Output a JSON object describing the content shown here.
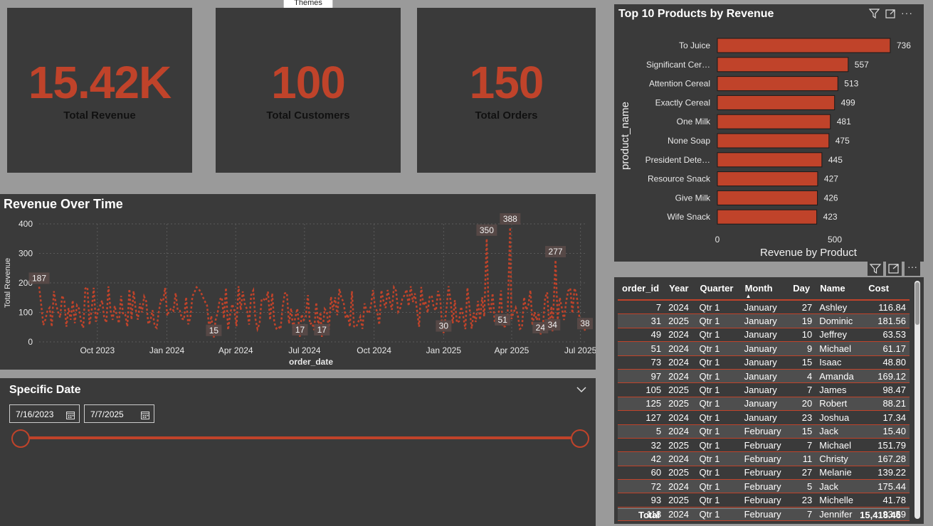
{
  "tooltip": "Themes",
  "kpis": [
    {
      "value": "15.42K",
      "label": "Total Revenue"
    },
    {
      "value": "100",
      "label": "Total Customers"
    },
    {
      "value": "150",
      "label": "Total Orders"
    }
  ],
  "colors": {
    "accent": "#c0432a",
    "panel": "#3a3a3a",
    "canvas": "#9a9a9a"
  },
  "revenue_chart": {
    "title": "Revenue Over Time",
    "ylabel": "Total Revenue",
    "xlabel": "order_date",
    "yticks": [
      "400",
      "300",
      "200",
      "100",
      "0"
    ],
    "xticks": [
      "Oct 2023",
      "Jan 2024",
      "Apr 2024",
      "Jul 2024",
      "Oct 2024",
      "Jan 2025",
      "Apr 2025",
      "Jul 2025"
    ],
    "point_labels": [
      "187",
      "15",
      "17",
      "17",
      "30",
      "350",
      "51",
      "388",
      "24",
      "34",
      "277",
      "38"
    ]
  },
  "slicer": {
    "title": "Specific Date",
    "start": "7/16/2023",
    "end": "7/7/2025",
    "chevron": "chevron-down-icon",
    "calendar_icon": "calendar-icon"
  },
  "products_chart": {
    "title": "Top 10 Products by Revenue",
    "ylabel": "product_name",
    "xlabel": "Revenue by Product",
    "xticks": [
      "0",
      "500"
    ],
    "icons": [
      "filter-icon",
      "focus-mode-icon",
      "more-options-icon"
    ]
  },
  "chart_data": [
    {
      "type": "bar",
      "title": "Top 10 Products by Revenue",
      "xlabel": "Revenue by Product",
      "ylabel": "product_name",
      "categories": [
        "To Juice",
        "Significant Cer…",
        "Attention Cereal",
        "Exactly Cereal",
        "One Milk",
        "None Soap",
        "President Dete…",
        "Resource Snack",
        "Give Milk",
        "Wife Snack"
      ],
      "values": [
        736,
        557,
        513,
        499,
        481,
        475,
        445,
        427,
        426,
        423
      ],
      "value_labels": [
        "736",
        "557",
        "513",
        "499",
        "481",
        "475",
        "445",
        "427",
        "426",
        "423"
      ],
      "xlim": [
        0,
        800
      ],
      "orientation": "horizontal",
      "grid": false
    },
    {
      "type": "line",
      "title": "Revenue Over Time",
      "xlabel": "order_date",
      "ylabel": "Total Revenue",
      "ylim": [
        0,
        400
      ],
      "x_range": [
        "2023-07-16",
        "2025-07-07"
      ],
      "grid": true,
      "labeled_points": [
        {
          "x": "2023-07-16",
          "y": 187
        },
        {
          "x": "2024-03-03",
          "y": 15
        },
        {
          "x": "2024-06-25",
          "y": 17
        },
        {
          "x": "2024-07-24",
          "y": 17
        },
        {
          "x": "2025-01-01",
          "y": 30
        },
        {
          "x": "2025-02-27",
          "y": 350
        },
        {
          "x": "2025-03-20",
          "y": 51
        },
        {
          "x": "2025-03-30",
          "y": 388
        },
        {
          "x": "2025-05-09",
          "y": 24
        },
        {
          "x": "2025-05-25",
          "y": 34
        },
        {
          "x": "2025-05-29",
          "y": 277
        },
        {
          "x": "2025-07-07",
          "y": 38
        }
      ]
    }
  ],
  "table": {
    "icons": [
      "filter-icon",
      "focus-mode-icon",
      "more-options-icon"
    ],
    "columns": [
      "order_id",
      "Year",
      "Quarter",
      "Month",
      "Day",
      "Name",
      "Cost"
    ],
    "rows": [
      [
        "7",
        "2024",
        "Qtr 1",
        "January",
        "27",
        "Ashley",
        "116.84"
      ],
      [
        "31",
        "2025",
        "Qtr 1",
        "January",
        "19",
        "Dominic",
        "181.56"
      ],
      [
        "49",
        "2024",
        "Qtr 1",
        "January",
        "10",
        "Jeffrey",
        "63.53"
      ],
      [
        "51",
        "2024",
        "Qtr 1",
        "January",
        "9",
        "Michael",
        "61.17"
      ],
      [
        "73",
        "2024",
        "Qtr 1",
        "January",
        "15",
        "Isaac",
        "48.80"
      ],
      [
        "97",
        "2024",
        "Qtr 1",
        "January",
        "4",
        "Amanda",
        "169.12"
      ],
      [
        "105",
        "2025",
        "Qtr 1",
        "January",
        "7",
        "James",
        "98.47"
      ],
      [
        "125",
        "2025",
        "Qtr 1",
        "January",
        "20",
        "Robert",
        "88.21"
      ],
      [
        "127",
        "2024",
        "Qtr 1",
        "January",
        "23",
        "Joshua",
        "17.34"
      ],
      [
        "5",
        "2024",
        "Qtr 1",
        "February",
        "15",
        "Jack",
        "15.40"
      ],
      [
        "32",
        "2025",
        "Qtr 1",
        "February",
        "7",
        "Michael",
        "151.79"
      ],
      [
        "42",
        "2024",
        "Qtr 1",
        "February",
        "11",
        "Christy",
        "167.28"
      ],
      [
        "60",
        "2025",
        "Qtr 1",
        "February",
        "27",
        "Melanie",
        "139.22"
      ],
      [
        "72",
        "2024",
        "Qtr 1",
        "February",
        "5",
        "Jack",
        "175.44"
      ],
      [
        "93",
        "2025",
        "Qtr 1",
        "February",
        "23",
        "Michelle",
        "41.78"
      ],
      [
        "118",
        "2024",
        "Qtr 1",
        "February",
        "7",
        "Jennifer",
        "93.59"
      ]
    ],
    "total_label": "Total",
    "total_value": "15,418.46"
  }
}
